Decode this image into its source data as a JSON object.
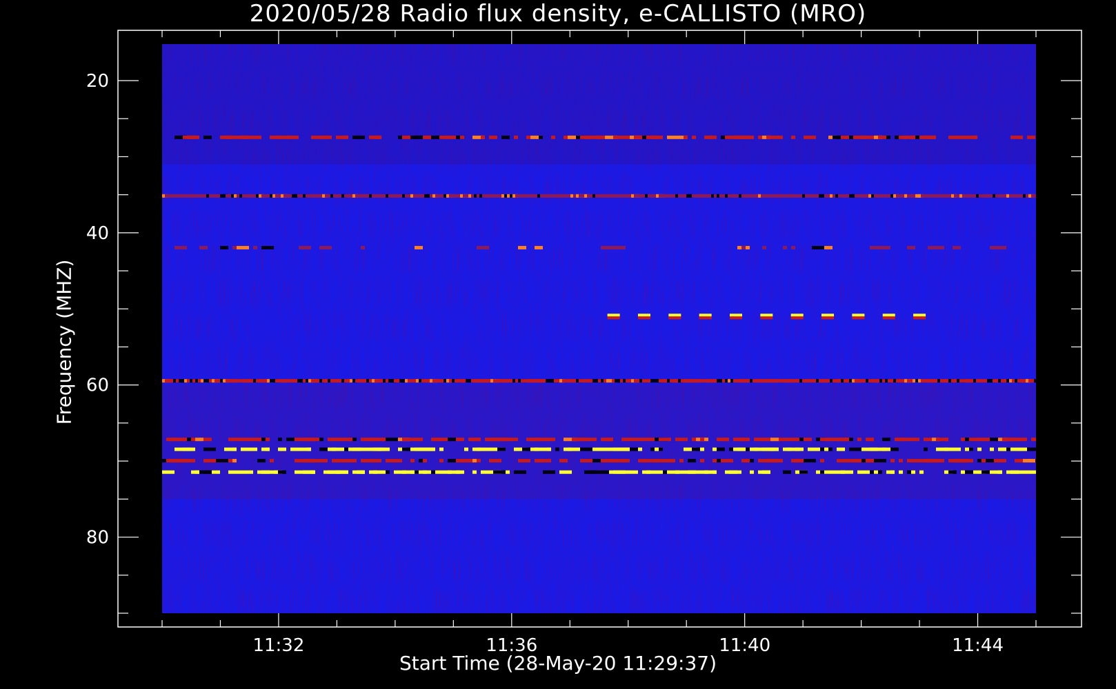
{
  "chart_data": {
    "type": "heatmap",
    "title": "2020/05/28  Radio flux density, e-CALLISTO (MRO)",
    "xlabel": "Start Time (28-May-20 11:29:37)",
    "ylabel": "Frequency (MHZ)",
    "x_unit": "time",
    "x_range": [
      "11:30:00",
      "11:45:00"
    ],
    "y_range_mhz": [
      15.2,
      90
    ],
    "y_axis_inverted": true,
    "x_major_ticks": [
      "11:32",
      "11:36",
      "11:40",
      "11:44"
    ],
    "y_major_ticks": [
      20,
      40,
      60,
      80
    ],
    "y_minor_tick_step": 5,
    "x_minor_tick_step_minutes": 1,
    "colormap": "blue-red-yellow",
    "colors": {
      "background": "#000000",
      "low": "#1a1ae6",
      "mid": "#c81a1a",
      "high": "#ffff30",
      "text": "#ffffff"
    },
    "emission_bands": [
      {
        "freq_mhz": 27.5,
        "intensity": "moderate",
        "pattern": "intermittent"
      },
      {
        "freq_mhz": 35.2,
        "intensity": "low",
        "pattern": "continuous"
      },
      {
        "freq_mhz": 42.0,
        "intensity": "low",
        "pattern": "sparse"
      },
      {
        "freq_mhz": 51.0,
        "intensity": "high",
        "pattern": "periodic",
        "time_range": [
          "11:37:45",
          "11:43:00"
        ]
      },
      {
        "freq_mhz": 59.5,
        "intensity": "moderate",
        "pattern": "continuous"
      },
      {
        "freq_mhz": 67.2,
        "intensity": "moderate",
        "pattern": "intermittent"
      },
      {
        "freq_mhz": 68.5,
        "intensity": "high",
        "pattern": "intermittent"
      },
      {
        "freq_mhz": 70.0,
        "intensity": "moderate",
        "pattern": "intermittent"
      },
      {
        "freq_mhz": 71.5,
        "intensity": "high",
        "pattern": "intermittent"
      }
    ]
  }
}
